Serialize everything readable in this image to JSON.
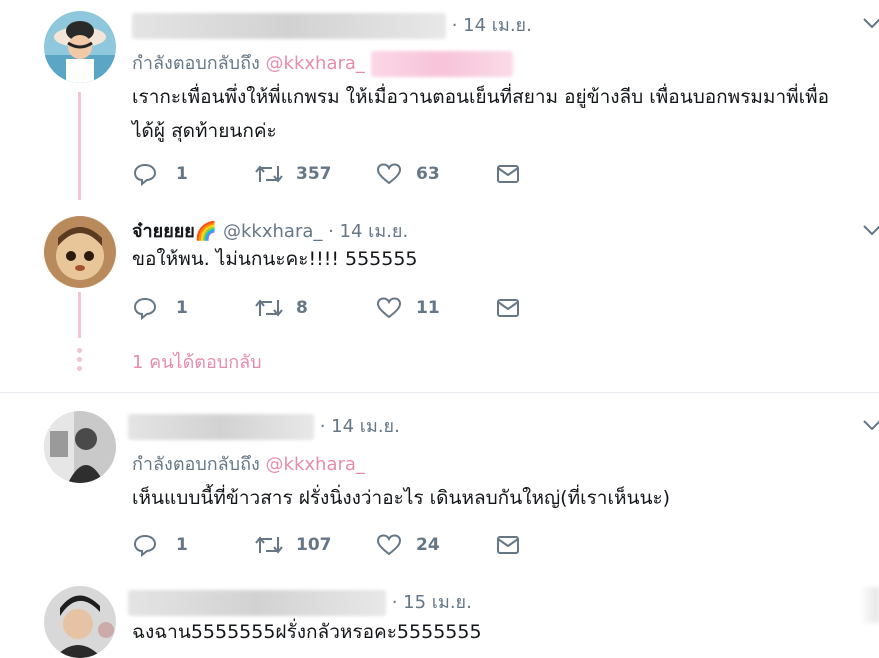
{
  "tweets": [
    {
      "date": "· 14 เม.ย.",
      "reply_prefix": "กำลังตอบกลับถึง",
      "reply_to": "@kkxhara_",
      "text_line1": "เรากะเพื่อนพึ่งให้พี่แกพรม ให้เมื่อวานตอนเย็นที่สยาม อยู่ข้างลีบ  เพื่อนบอกพรมมาพี่เพื่อ",
      "text_line2": "ได้ผู้ สุดท้ายนกค่ะ",
      "replies": "1",
      "retweets": "357",
      "likes": "63"
    },
    {
      "name": "จ๋ายยยย🌈",
      "handle": "@kkxhara_",
      "date": "· 14 เม.ย.",
      "text": "ขอให้พน. ไม่นกนะคะ!!!! 555555",
      "replies": "1",
      "retweets": "8",
      "likes": "11",
      "more_replies": "1 คนได้ตอบกลับ"
    },
    {
      "date": "· 14 เม.ย.",
      "reply_prefix": "กำลังตอบกลับถึง",
      "reply_to": "@kkxhara_",
      "text": "เห็นแบบนี้ที่ข้าวสาร ฝรั่งนิ่งงว่าอะไร เดินหลบกันใหญ่(ที่เราเห็นนะ)",
      "replies": "1",
      "retweets": "107",
      "likes": "24"
    },
    {
      "date": "· 15 เม.ย.",
      "text": "ฉงฉาน5555555ฝรั่งกลัวหรอคะ5555555"
    }
  ],
  "colors": {
    "accent_pink": "#e88cae",
    "thread_line": "#f7c5d9",
    "muted": "#657786"
  },
  "icons": [
    "chevron-down-icon",
    "reply-icon",
    "retweet-icon",
    "like-icon",
    "message-icon"
  ]
}
